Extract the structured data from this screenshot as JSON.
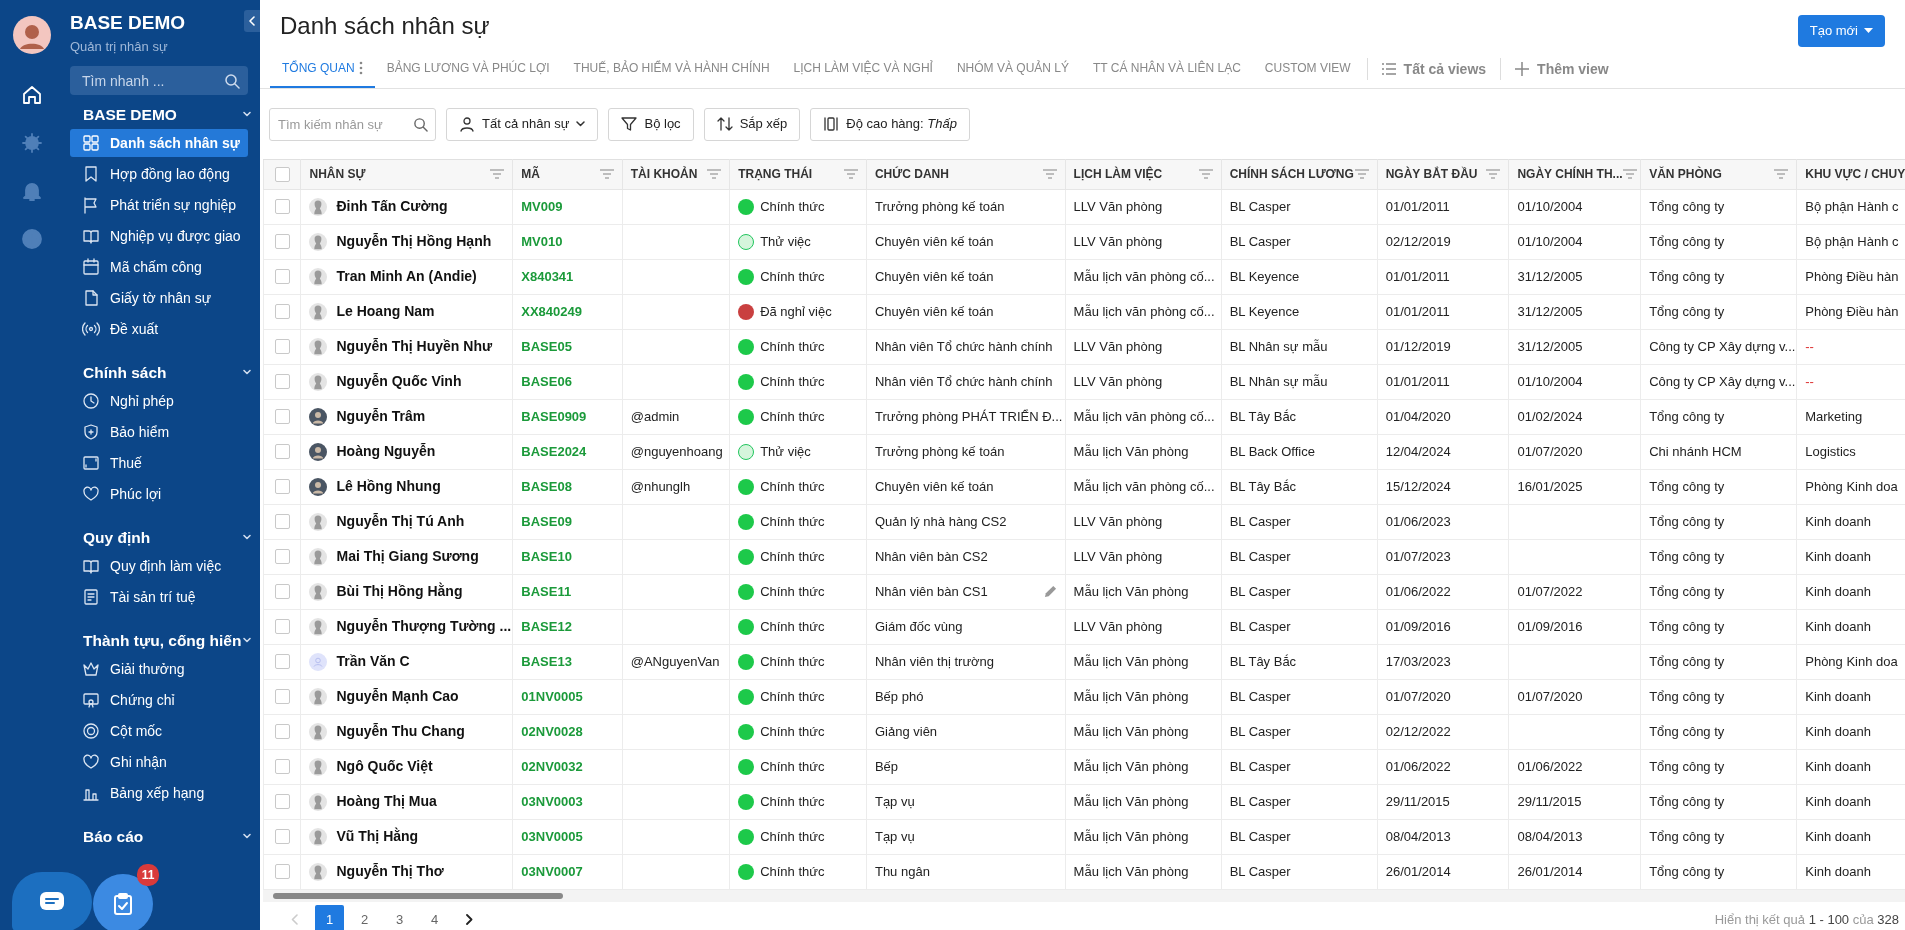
{
  "sidebar": {
    "title": "BASE DEMO",
    "subtitle": "Quản trị nhân sự",
    "search": {
      "placeholder": "Tìm nhanh ..."
    },
    "rail": [
      {
        "selected": true
      },
      {
        "selected": false
      },
      {
        "selected": false
      },
      {
        "selected": false
      }
    ],
    "sections": [
      {
        "title": "BASE DEMO",
        "expanded": true,
        "items": [
          {
            "label": "Danh sách nhân sự",
            "selected": true
          },
          {
            "label": "Hợp đồng lao động",
            "selected": false
          },
          {
            "label": "Phát triển sự nghiệp",
            "selected": false
          },
          {
            "label": "Nghiệp vụ được giao",
            "selected": false
          },
          {
            "label": "Mã chấm công",
            "selected": false
          },
          {
            "label": "Giấy tờ nhân sự",
            "selected": false
          },
          {
            "label": "Đề xuất",
            "selected": false
          }
        ]
      },
      {
        "title": "Chính sách",
        "expanded": true,
        "items": [
          {
            "label": "Nghỉ phép",
            "selected": false
          },
          {
            "label": "Bảo hiểm",
            "selected": false
          },
          {
            "label": "Thuế",
            "selected": false
          },
          {
            "label": "Phúc lợi",
            "selected": false
          }
        ]
      },
      {
        "title": "Quy định",
        "expanded": true,
        "items": [
          {
            "label": "Quy định làm việc",
            "selected": false
          },
          {
            "label": "Tài sản trí tuệ",
            "selected": false
          }
        ]
      },
      {
        "title": "Thành tựu, cống hiến",
        "expanded": true,
        "items": [
          {
            "label": "Giải thưởng",
            "selected": false
          },
          {
            "label": "Chứng chỉ",
            "selected": false
          },
          {
            "label": "Cột mốc",
            "selected": false
          },
          {
            "label": "Ghi nhận",
            "selected": false
          },
          {
            "label": "Bảng xếp hạng",
            "selected": false
          }
        ]
      },
      {
        "title": "Báo cáo",
        "expanded": true
      }
    ],
    "task_badge": "11"
  },
  "page": {
    "title": "Danh sách nhân sự",
    "create_button": "Tạo mới"
  },
  "tabs": [
    {
      "label": "TỔNG QUAN",
      "selected": true
    },
    {
      "label": "BẢNG LƯƠNG VÀ PHÚC LỢI",
      "selected": false
    },
    {
      "label": "THUẾ, BẢO HIỂM VÀ HÀNH CHÍNH",
      "selected": false
    },
    {
      "label": "LỊCH LÀM VIỆC VÀ NGHỈ",
      "selected": false
    },
    {
      "label": "NHÓM VÀ QUẢN LÝ",
      "selected": false
    },
    {
      "label": "TT CÁ NHÂN VÀ LIÊN LẠC",
      "selected": false
    },
    {
      "label": "CUSTOM VIEW",
      "selected": false
    }
  ],
  "view_links": {
    "all_views": "Tất cả views",
    "add_view": "Thêm view"
  },
  "toolbar": {
    "search": {
      "placeholder": "Tìm kiếm nhân sự"
    },
    "scope": "Tất cả nhân sự",
    "filter": "Bộ lọc",
    "sort": "Sắp xếp",
    "row_height": "Độ cao hàng: *Thấp*"
  },
  "table": {
    "all_checked": false,
    "columns": [
      "NHÂN SỰ",
      "MÃ",
      "TÀI KHOẢN",
      "TRẠNG THÁI",
      "CHỨC DANH",
      "LỊCH LÀM VIỆC",
      "CHÍNH SÁCH LƯƠNG",
      "NGÀY BẮT ĐẦU",
      "NGÀY CHÍNH TH...",
      "VĂN PHÒNG",
      "KHU VỰC / CHUY"
    ],
    "rows": [
      {
        "checked": false,
        "hovered": false,
        "kind": "generic",
        "name": "Đinh Tấn Cường",
        "code": "MV009",
        "account": "",
        "status": {
          "text": "Chính thức",
          "color": "#1dc94a"
        },
        "title": "Trưởng phòng kế toán",
        "schedule": "LLV Văn phòng",
        "salary": "BL Casper",
        "start": "01/01/2011",
        "official": "01/10/2004",
        "office": "Tổng công ty",
        "area": "Bộ phận Hành c",
        "area_missing": false
      },
      {
        "checked": false,
        "hovered": false,
        "kind": "generic",
        "name": "Nguyễn Thị Hồng Hạnh",
        "code": "MV010",
        "account": "",
        "status": {
          "text": "Thử việc",
          "color": "#d5f5dc"
        },
        "title": "Chuyên viên kế toán",
        "schedule": "LLV Văn phòng",
        "salary": "BL Casper",
        "start": "02/12/2019",
        "official": "01/10/2004",
        "office": "Tổng công ty",
        "area": "Bộ phận Hành c",
        "area_missing": false
      },
      {
        "checked": false,
        "hovered": false,
        "kind": "generic",
        "name": "Tran Minh An (Andie)",
        "code": "X840341",
        "account": "",
        "status": {
          "text": "Chính thức",
          "color": "#1dc94a"
        },
        "title": "Chuyên viên kế toán",
        "schedule": "Mẫu lịch văn phòng cố...",
        "salary": "BL Keyence",
        "start": "01/01/2011",
        "official": "31/12/2005",
        "office": "Tổng công ty",
        "area": "Phòng Điều hàn",
        "area_missing": false
      },
      {
        "checked": false,
        "hovered": false,
        "kind": "generic",
        "name": "Le Hoang Nam",
        "code": "XX840249",
        "account": "",
        "status": {
          "text": "Đã nghỉ việc",
          "color": "#c94040"
        },
        "title": "Chuyên viên kế toán",
        "schedule": "Mẫu lịch văn phòng cố...",
        "salary": "BL Keyence",
        "start": "01/01/2011",
        "official": "31/12/2005",
        "office": "Tổng công ty",
        "area": "Phòng Điều hàn",
        "area_missing": false
      },
      {
        "checked": false,
        "hovered": false,
        "kind": "generic",
        "name": "Nguyễn Thị Huyền Như",
        "code": "BASE05",
        "account": "",
        "status": {
          "text": "Chính thức",
          "color": "#1dc94a"
        },
        "title": "Nhân viên Tổ chức hành chính",
        "schedule": "LLV Văn phòng",
        "salary": "BL Nhân sự mẫu",
        "start": "01/12/2019",
        "official": "31/12/2005",
        "office": "Công ty CP Xây dựng v...",
        "area": "--",
        "area_missing": true
      },
      {
        "checked": false,
        "hovered": false,
        "kind": "generic",
        "name": "Nguyễn Quốc Vinh",
        "code": "BASE06",
        "account": "",
        "status": {
          "text": "Chính thức",
          "color": "#1dc94a"
        },
        "title": "Nhân viên Tổ chức hành chính",
        "schedule": "LLV Văn phòng",
        "salary": "BL Nhân sự mẫu",
        "start": "01/01/2011",
        "official": "01/10/2004",
        "office": "Công ty CP Xây dựng v...",
        "area": "--",
        "area_missing": true
      },
      {
        "checked": false,
        "hovered": false,
        "kind": "photo",
        "name": "Nguyễn Trâm",
        "code": "BASE0909",
        "account": "@admin",
        "status": {
          "text": "Chính thức",
          "color": "#1dc94a"
        },
        "title": "Trưởng phòng PHÁT TRIỂN Đ...",
        "schedule": "Mẫu lịch văn phòng cố...",
        "salary": "BL Tây Bắc",
        "start": "01/04/2020",
        "official": "01/02/2024",
        "office": "Tổng công ty",
        "area": "Marketing",
        "area_missing": false
      },
      {
        "checked": false,
        "hovered": false,
        "kind": "photo",
        "name": "Hoàng Nguyễn",
        "code": "BASE2024",
        "account": "@nguyenhoang",
        "status": {
          "text": "Thử việc",
          "color": "#d5f5dc"
        },
        "title": "Trưởng phòng kế toán",
        "schedule": "Mẫu lịch Văn phòng",
        "salary": "BL Back Office",
        "start": "12/04/2024",
        "official": "01/07/2020",
        "office": "Chi nhánh HCM",
        "area": "Logistics",
        "area_missing": false
      },
      {
        "checked": false,
        "hovered": false,
        "kind": "photo",
        "name": "Lê Hồng Nhung",
        "code": "BASE08",
        "account": "@nhunglh",
        "status": {
          "text": "Chính thức",
          "color": "#1dc94a"
        },
        "title": "Chuyên viên kế toán",
        "schedule": "Mẫu lịch văn phòng cố...",
        "salary": "BL Tây Bắc",
        "start": "15/12/2024",
        "official": "16/01/2025",
        "office": "Tổng công ty",
        "area": "Phòng Kinh doa",
        "area_missing": false
      },
      {
        "checked": false,
        "hovered": false,
        "kind": "generic",
        "name": "Nguyễn Thị Tú Anh",
        "code": "BASE09",
        "account": "",
        "status": {
          "text": "Chính thức",
          "color": "#1dc94a"
        },
        "title": "Quản lý nhà hàng CS2",
        "schedule": "LLV Văn phòng",
        "salary": "BL Casper",
        "start": "01/06/2023",
        "official": "",
        "office": "Tổng công ty",
        "area": "Kinh doanh",
        "area_missing": false
      },
      {
        "checked": false,
        "hovered": false,
        "kind": "generic",
        "name": "Mai Thị Giang Sương",
        "code": "BASE10",
        "account": "",
        "status": {
          "text": "Chính thức",
          "color": "#1dc94a"
        },
        "title": "Nhân viên bàn CS2",
        "schedule": "LLV Văn phòng",
        "salary": "BL Casper",
        "start": "01/07/2023",
        "official": "",
        "office": "Tổng công ty",
        "area": "Kinh doanh",
        "area_missing": false
      },
      {
        "checked": false,
        "hovered": true,
        "kind": "generic",
        "name": "Bùi Thị Hồng Hằng",
        "code": "BASE11",
        "account": "",
        "status": {
          "text": "Chính thức",
          "color": "#1dc94a"
        },
        "title": "Nhân viên bàn CS1",
        "schedule": "Mẫu lịch Văn phòng",
        "salary": "BL Casper",
        "start": "01/06/2022",
        "official": "01/07/2022",
        "office": "Tổng công ty",
        "area": "Kinh doanh",
        "area_missing": false
      },
      {
        "checked": false,
        "hovered": false,
        "kind": "generic",
        "name": "Nguyễn Thượng Tường ...",
        "code": "BASE12",
        "account": "",
        "status": {
          "text": "Chính thức",
          "color": "#1dc94a"
        },
        "title": "Giám đốc vùng",
        "schedule": "LLV Văn phòng",
        "salary": "BL Casper",
        "start": "01/09/2016",
        "official": "01/09/2016",
        "office": "Tổng công ty",
        "area": "Kinh doanh",
        "area_missing": false
      },
      {
        "checked": false,
        "hovered": false,
        "kind": "blank",
        "name": "Trần Văn C",
        "code": "BASE13",
        "account": "@ANguyenVan",
        "status": {
          "text": "Chính thức",
          "color": "#1dc94a"
        },
        "title": "Nhân viên thị trường",
        "schedule": "Mẫu lịch Văn phòng",
        "salary": "BL Tây Bắc",
        "start": "17/03/2023",
        "official": "",
        "office": "Tổng công ty",
        "area": "Phòng Kinh doa",
        "area_missing": false
      },
      {
        "checked": false,
        "hovered": false,
        "kind": "generic",
        "name": "Nguyễn Mạnh Cao",
        "code": "01NV0005",
        "account": "",
        "status": {
          "text": "Chính thức",
          "color": "#1dc94a"
        },
        "title": "Bếp phó",
        "schedule": "Mẫu lịch Văn phòng",
        "salary": "BL Casper",
        "start": "01/07/2020",
        "official": "01/07/2020",
        "office": "Tổng công ty",
        "area": "Kinh doanh",
        "area_missing": false
      },
      {
        "checked": false,
        "hovered": false,
        "kind": "generic",
        "name": "Nguyễn Thu Chang",
        "code": "02NV0028",
        "account": "",
        "status": {
          "text": "Chính thức",
          "color": "#1dc94a"
        },
        "title": "Giảng viên",
        "schedule": "Mẫu lịch Văn phòng",
        "salary": "BL Casper",
        "start": "02/12/2022",
        "official": "",
        "office": "Tổng công ty",
        "area": "Kinh doanh",
        "area_missing": false
      },
      {
        "checked": false,
        "hovered": false,
        "kind": "generic",
        "name": "Ngô Quốc Việt",
        "code": "02NV0032",
        "account": "",
        "status": {
          "text": "Chính thức",
          "color": "#1dc94a"
        },
        "title": "Bếp",
        "schedule": "Mẫu lịch Văn phòng",
        "salary": "BL Casper",
        "start": "01/06/2022",
        "official": "01/06/2022",
        "office": "Tổng công ty",
        "area": "Kinh doanh",
        "area_missing": false
      },
      {
        "checked": false,
        "hovered": false,
        "kind": "generic",
        "name": "Hoàng Thị Mua",
        "code": "03NV0003",
        "account": "",
        "status": {
          "text": "Chính thức",
          "color": "#1dc94a"
        },
        "title": "Tạp vụ",
        "schedule": "Mẫu lịch Văn phòng",
        "salary": "BL Casper",
        "start": "29/11/2015",
        "official": "29/11/2015",
        "office": "Tổng công ty",
        "area": "Kinh doanh",
        "area_missing": false
      },
      {
        "checked": false,
        "hovered": false,
        "kind": "generic",
        "name": "Vũ Thị Hằng",
        "code": "03NV0005",
        "account": "",
        "status": {
          "text": "Chính thức",
          "color": "#1dc94a"
        },
        "title": "Tạp vụ",
        "schedule": "Mẫu lịch Văn phòng",
        "salary": "BL Casper",
        "start": "08/04/2013",
        "official": "08/04/2013",
        "office": "Tổng công ty",
        "area": "Kinh doanh",
        "area_missing": false
      },
      {
        "checked": false,
        "hovered": false,
        "kind": "generic",
        "name": "Nguyễn Thị Thơ",
        "code": "03NV0007",
        "account": "",
        "status": {
          "text": "Chính thức",
          "color": "#1dc94a"
        },
        "title": "Thu ngân",
        "schedule": "Mẫu lịch Văn phòng",
        "salary": "BL Casper",
        "start": "26/01/2014",
        "official": "26/01/2014",
        "office": "Tổng công ty",
        "area": "Kinh doanh",
        "area_missing": false
      }
    ]
  },
  "pagination": {
    "pages": [
      {
        "label": "1",
        "selected": true
      },
      {
        "label": "2",
        "selected": false
      },
      {
        "label": "3",
        "selected": false
      },
      {
        "label": "4",
        "selected": false
      }
    ],
    "prev_disabled": true,
    "summary": "Hiển thị kết quả **1 - 100** của **328**"
  }
}
